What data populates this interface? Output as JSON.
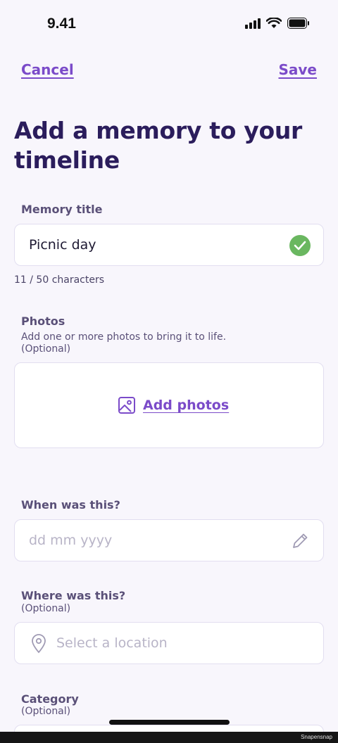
{
  "status_bar": {
    "time": "9.41"
  },
  "nav": {
    "cancel_label": "Cancel",
    "save_label": "Save"
  },
  "page": {
    "title": "Add a memory to your timeline"
  },
  "memory_title": {
    "label": "Memory title",
    "value": "Picnic day",
    "counter": "11 / 50 characters",
    "valid_icon": "check-circle-icon"
  },
  "photos": {
    "label": "Photos",
    "hint": "Add one or more photos to bring it to life.",
    "optional": "(Optional)",
    "button_label": "Add photos",
    "icon": "image-icon"
  },
  "date": {
    "label": "When was this?",
    "placeholder": "dd mm yyyy",
    "icon": "pencil-icon"
  },
  "location": {
    "label": "Where was this?",
    "optional": "(Optional)",
    "placeholder": "Select a location",
    "icon": "location-pin-icon"
  },
  "category": {
    "label": "Category",
    "optional": "(Optional)"
  },
  "watermark": "Snapensnap",
  "colors": {
    "accent": "#7b4bc9",
    "heading": "#2b1d5c",
    "success": "#6ab760",
    "background": "#f8f6fc"
  }
}
